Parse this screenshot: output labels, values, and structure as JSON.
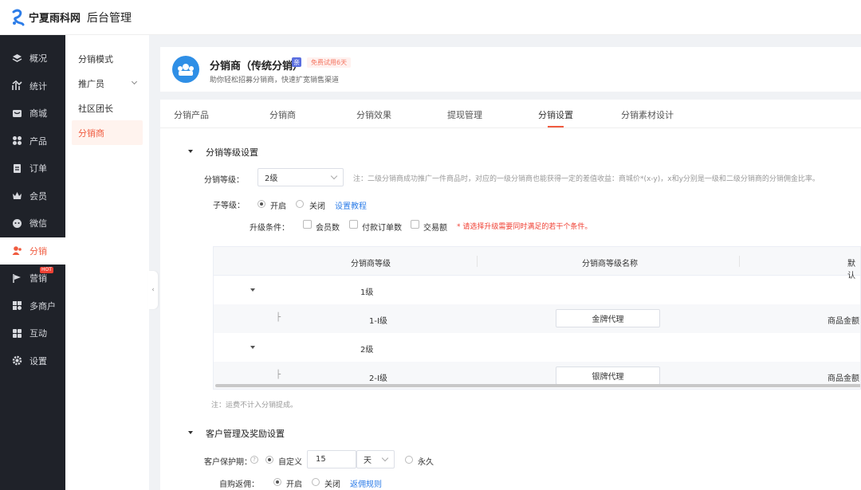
{
  "topbar": {
    "logo_text": "宁夏雨科网",
    "app_title": "后台管理"
  },
  "leftnav": {
    "items": [
      {
        "label": "概况",
        "icon": "layers-icon"
      },
      {
        "label": "统计",
        "icon": "chart-icon"
      },
      {
        "label": "商城",
        "icon": "store-icon"
      },
      {
        "label": "产品",
        "icon": "grid-icon"
      },
      {
        "label": "订单",
        "icon": "order-icon"
      },
      {
        "label": "会员",
        "icon": "crown-icon"
      },
      {
        "label": "微信",
        "icon": "wechat-icon"
      },
      {
        "label": "分销",
        "icon": "distribution-icon"
      },
      {
        "label": "营销",
        "icon": "flag-icon",
        "badge": "HOT"
      },
      {
        "label": "多商户",
        "icon": "merchant-icon"
      },
      {
        "label": "互动",
        "icon": "interact-icon"
      },
      {
        "label": "设置",
        "icon": "gear-icon"
      }
    ]
  },
  "subnav": {
    "items": [
      {
        "label": "分销模式"
      },
      {
        "label": "推广员"
      },
      {
        "label": "社区团长"
      },
      {
        "label": "分销商"
      }
    ]
  },
  "header": {
    "title": "分销商（传统分销）",
    "badge_icon": "亲",
    "trial_badge": "免费试用6天",
    "desc": "助你轻松招募分销商，快速扩宽销售渠道"
  },
  "tabs": [
    "分销产品",
    "分销商",
    "分销效果",
    "提现管理",
    "分销设置",
    "分销素材设计"
  ],
  "level_section": {
    "title": "分销等级设置",
    "level_label": "分销等级：",
    "level_value": "2级",
    "level_note": "注：二级分销商成功推广一件商品时，对应的一级分销商也能获得一定的差值收益：商城价*(x-y)，x和y分别是一级和二级分销商的分销佣金比率。",
    "sub_label": "子等级：",
    "sub_on": "开启",
    "sub_off": "关闭",
    "sub_link": "设置教程",
    "upgrade_label": "升级条件：",
    "upgrade_opts": [
      "会员数",
      "付款订单数",
      "交易额"
    ],
    "upgrade_warn": "* 请选择升级需要同时满足的若干个条件。",
    "table": {
      "headers": [
        "分销商等级",
        "分销商等级名称",
        "默认"
      ],
      "rows": [
        {
          "level": "1级",
          "type": "group"
        },
        {
          "level": "1-I级",
          "type": "child",
          "name": "金牌代理",
          "extra": "商品金额 x"
        },
        {
          "level": "2级",
          "type": "group"
        },
        {
          "level": "2-I级",
          "type": "child",
          "name": "银牌代理",
          "extra": "商品金额 x"
        }
      ],
      "tree_mark": "├"
    },
    "footnote": "注：运费不计入分销提成。"
  },
  "customer_section": {
    "title": "客户管理及奖励设置",
    "protect_label": "客户保护期：",
    "custom_label": "自定义",
    "days_value": "15",
    "unit_value": "天",
    "forever_label": "永久",
    "rebate_label": "自购返佣：",
    "rebate_on": "开启",
    "rebate_off": "关闭",
    "rebate_link": "返佣规则"
  },
  "colors": {
    "accent": "#f05b3f",
    "sidebar": "#1f2229",
    "link": "#2d7de8"
  }
}
